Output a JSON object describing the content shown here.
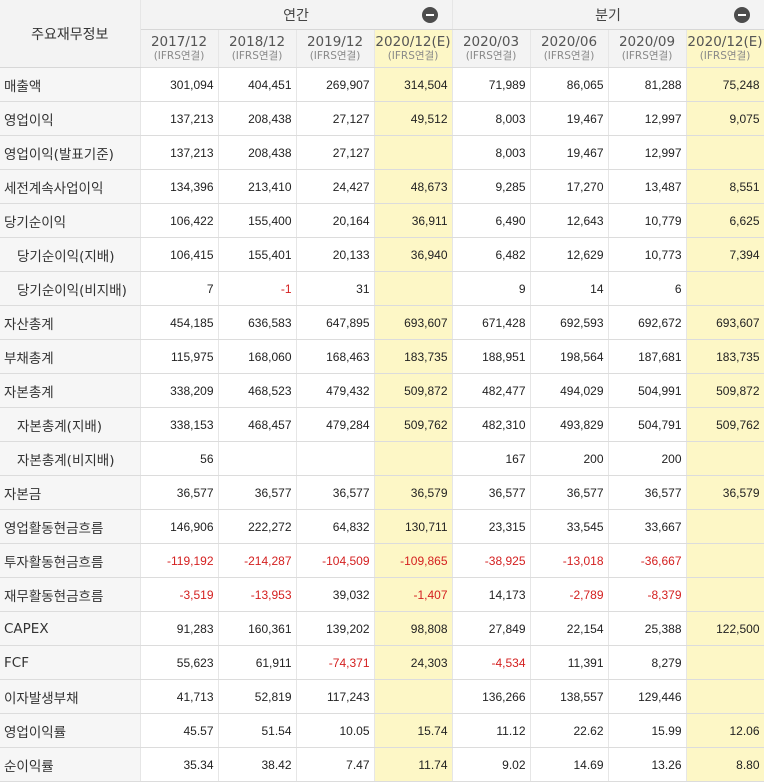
{
  "header": {
    "corner": "주요재무정보",
    "groups": {
      "annual": "연간",
      "quarterly": "분기"
    },
    "periods": [
      {
        "year": "2017/12",
        "sub": "(IFRS연결)"
      },
      {
        "year": "2018/12",
        "sub": "(IFRS연결)"
      },
      {
        "year": "2019/12",
        "sub": "(IFRS연결)"
      },
      {
        "year": "2020/12(E)",
        "sub": "(IFRS연결)"
      },
      {
        "year": "2020/03",
        "sub": "(IFRS연결)"
      },
      {
        "year": "2020/06",
        "sub": "(IFRS연결)"
      },
      {
        "year": "2020/09",
        "sub": "(IFRS연결)"
      },
      {
        "year": "2020/12(E)",
        "sub": "(IFRS연결)"
      }
    ]
  },
  "rows": [
    {
      "label": "매출액",
      "indent": false,
      "values": [
        "301,094",
        "404,451",
        "269,907",
        "314,504",
        "71,989",
        "86,065",
        "81,288",
        "75,248"
      ]
    },
    {
      "label": "영업이익",
      "indent": false,
      "values": [
        "137,213",
        "208,438",
        "27,127",
        "49,512",
        "8,003",
        "19,467",
        "12,997",
        "9,075"
      ]
    },
    {
      "label": "영업이익(발표기준)",
      "indent": false,
      "values": [
        "137,213",
        "208,438",
        "27,127",
        "",
        "8,003",
        "19,467",
        "12,997",
        ""
      ]
    },
    {
      "label": "세전계속사업이익",
      "indent": false,
      "values": [
        "134,396",
        "213,410",
        "24,427",
        "48,673",
        "9,285",
        "17,270",
        "13,487",
        "8,551"
      ]
    },
    {
      "label": "당기순이익",
      "indent": false,
      "values": [
        "106,422",
        "155,400",
        "20,164",
        "36,911",
        "6,490",
        "12,643",
        "10,779",
        "6,625"
      ]
    },
    {
      "label": "당기순이익(지배)",
      "indent": true,
      "values": [
        "106,415",
        "155,401",
        "20,133",
        "36,940",
        "6,482",
        "12,629",
        "10,773",
        "7,394"
      ]
    },
    {
      "label": "당기순이익(비지배)",
      "indent": true,
      "values": [
        "7",
        "-1",
        "31",
        "",
        "9",
        "14",
        "6",
        ""
      ]
    },
    {
      "label": "자산총계",
      "indent": false,
      "values": [
        "454,185",
        "636,583",
        "647,895",
        "693,607",
        "671,428",
        "692,593",
        "692,672",
        "693,607"
      ]
    },
    {
      "label": "부채총계",
      "indent": false,
      "values": [
        "115,975",
        "168,060",
        "168,463",
        "183,735",
        "188,951",
        "198,564",
        "187,681",
        "183,735"
      ]
    },
    {
      "label": "자본총계",
      "indent": false,
      "values": [
        "338,209",
        "468,523",
        "479,432",
        "509,872",
        "482,477",
        "494,029",
        "504,991",
        "509,872"
      ]
    },
    {
      "label": "자본총계(지배)",
      "indent": true,
      "values": [
        "338,153",
        "468,457",
        "479,284",
        "509,762",
        "482,310",
        "493,829",
        "504,791",
        "509,762"
      ]
    },
    {
      "label": "자본총계(비지배)",
      "indent": true,
      "values": [
        "56",
        "",
        "",
        "",
        "167",
        "200",
        "200",
        ""
      ]
    },
    {
      "label": "자본금",
      "indent": false,
      "values": [
        "36,577",
        "36,577",
        "36,577",
        "36,579",
        "36,577",
        "36,577",
        "36,577",
        "36,579"
      ]
    },
    {
      "label": "영업활동현금흐름",
      "indent": false,
      "values": [
        "146,906",
        "222,272",
        "64,832",
        "130,711",
        "23,315",
        "33,545",
        "33,667",
        ""
      ]
    },
    {
      "label": "투자활동현금흐름",
      "indent": false,
      "values": [
        "-119,192",
        "-214,287",
        "-104,509",
        "-109,865",
        "-38,925",
        "-13,018",
        "-36,667",
        ""
      ]
    },
    {
      "label": "재무활동현금흐름",
      "indent": false,
      "values": [
        "-3,519",
        "-13,953",
        "39,032",
        "-1,407",
        "14,173",
        "-2,789",
        "-8,379",
        ""
      ]
    },
    {
      "label": "CAPEX",
      "indent": false,
      "values": [
        "91,283",
        "160,361",
        "139,202",
        "98,808",
        "27,849",
        "22,154",
        "25,388",
        "122,500"
      ]
    },
    {
      "label": "FCF",
      "indent": false,
      "values": [
        "55,623",
        "61,911",
        "-74,371",
        "24,303",
        "-4,534",
        "11,391",
        "8,279",
        ""
      ]
    },
    {
      "label": "이자발생부채",
      "indent": false,
      "values": [
        "41,713",
        "52,819",
        "117,243",
        "",
        "136,266",
        "138,557",
        "129,446",
        ""
      ]
    },
    {
      "label": "영업이익률",
      "indent": false,
      "values": [
        "45.57",
        "51.54",
        "10.05",
        "15.74",
        "11.12",
        "22.62",
        "15.99",
        "12.06"
      ]
    },
    {
      "label": "순이익률",
      "indent": false,
      "values": [
        "35.34",
        "38.42",
        "7.47",
        "11.74",
        "9.02",
        "14.69",
        "13.26",
        "8.80"
      ]
    }
  ],
  "style": {
    "estimate_bg": "#fdf7c6",
    "negative_color": "#d42020",
    "header_bg": "#f3f3f3"
  }
}
